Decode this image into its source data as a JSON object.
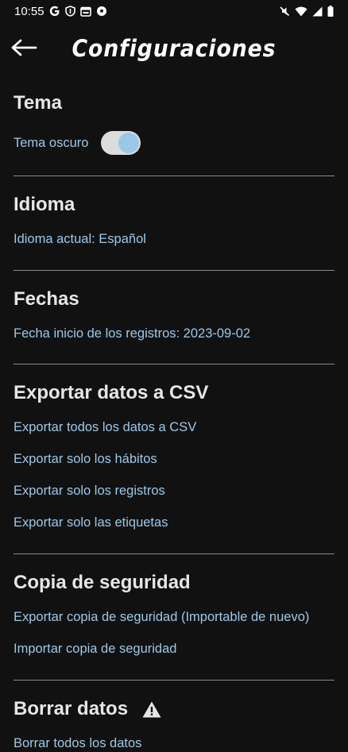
{
  "status_bar": {
    "time": "10:55",
    "icons": [
      "google-icon",
      "shield-icon",
      "calendar-icon",
      "soccer-ball-icon",
      "mute-icon",
      "wifi-icon",
      "signal-icon",
      "battery-icon"
    ]
  },
  "app_bar": {
    "back_icon": "arrow-left-icon",
    "title": "Configuraciones"
  },
  "sections": {
    "tema": {
      "title": "Tema",
      "dark_mode_label": "Tema oscuro",
      "dark_mode_on": true
    },
    "idioma": {
      "title": "Idioma",
      "current": "Idioma actual: Español"
    },
    "fechas": {
      "title": "Fechas",
      "start_date": "Fecha inicio de los registros: 2023-09-02"
    },
    "exportar_csv": {
      "title": "Exportar datos a CSV",
      "items": [
        "Exportar todos los datos a CSV",
        "Exportar solo los hábitos",
        "Exportar solo los registros",
        "Exportar solo las etiquetas"
      ]
    },
    "copia": {
      "title": "Copia de seguridad",
      "items": [
        "Exportar copia de seguridad (Importable de nuevo)",
        "Importar copia de seguridad"
      ]
    },
    "borrar": {
      "title": "Borrar datos",
      "icon": "warning-icon",
      "items": [
        "Borrar todos los datos"
      ]
    }
  },
  "colors": {
    "background": "#111111",
    "accent": "#9bc8e8",
    "divider": "#8a8a8a",
    "heading": "#e6e6e6"
  }
}
